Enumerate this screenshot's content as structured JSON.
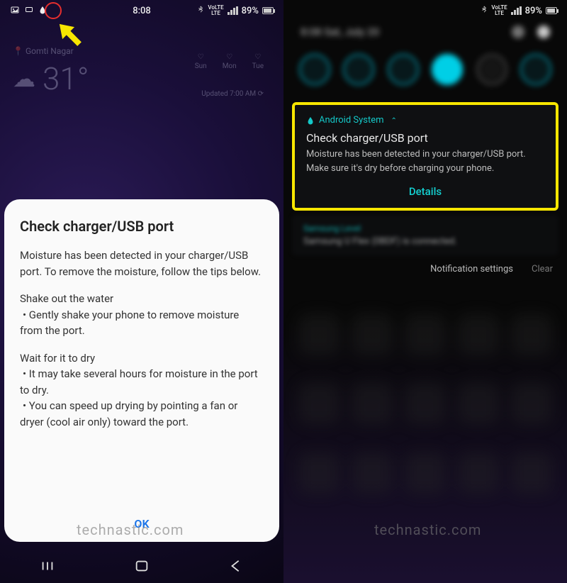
{
  "statusbar": {
    "time": "8:08",
    "battery_pct": "89%",
    "volte": "VoLTE",
    "lte": "LTE"
  },
  "weather": {
    "location": "Gomti Nagar",
    "temp": "31°",
    "days": [
      "Sun",
      "Mon",
      "Tue"
    ],
    "updated": "Updated 7:00 AM"
  },
  "dialog": {
    "title": "Check charger/USB port",
    "intro": "Moisture has been detected in your charger/USB port. To remove the moisture, follow the tips below.",
    "step1_title": "Shake out the water",
    "step1_bullet": " • Gently shake your phone to remove moisture from the port.",
    "step2_title": "Wait for it to dry",
    "step2_bullet1": " • It may take several hours for moisture in the port to dry.",
    "step2_bullet2": " • You can speed up drying by pointing a fan or dryer (cool air only) toward the port.",
    "ok": "OK"
  },
  "shade": {
    "date": "8:08  Sat, July 20"
  },
  "notification": {
    "source": "Android System",
    "title": "Check charger/USB port",
    "body": "Moisture has been detected in your charger/USB port. Make sure it's dry before charging your phone.",
    "action": "Details"
  },
  "notification2": {
    "source": "Samsung Level",
    "line": "Samsung U Flex (0BDF) is connected."
  },
  "footer": {
    "settings": "Notification settings",
    "clear": "Clear"
  },
  "watermark": "technastic.com"
}
